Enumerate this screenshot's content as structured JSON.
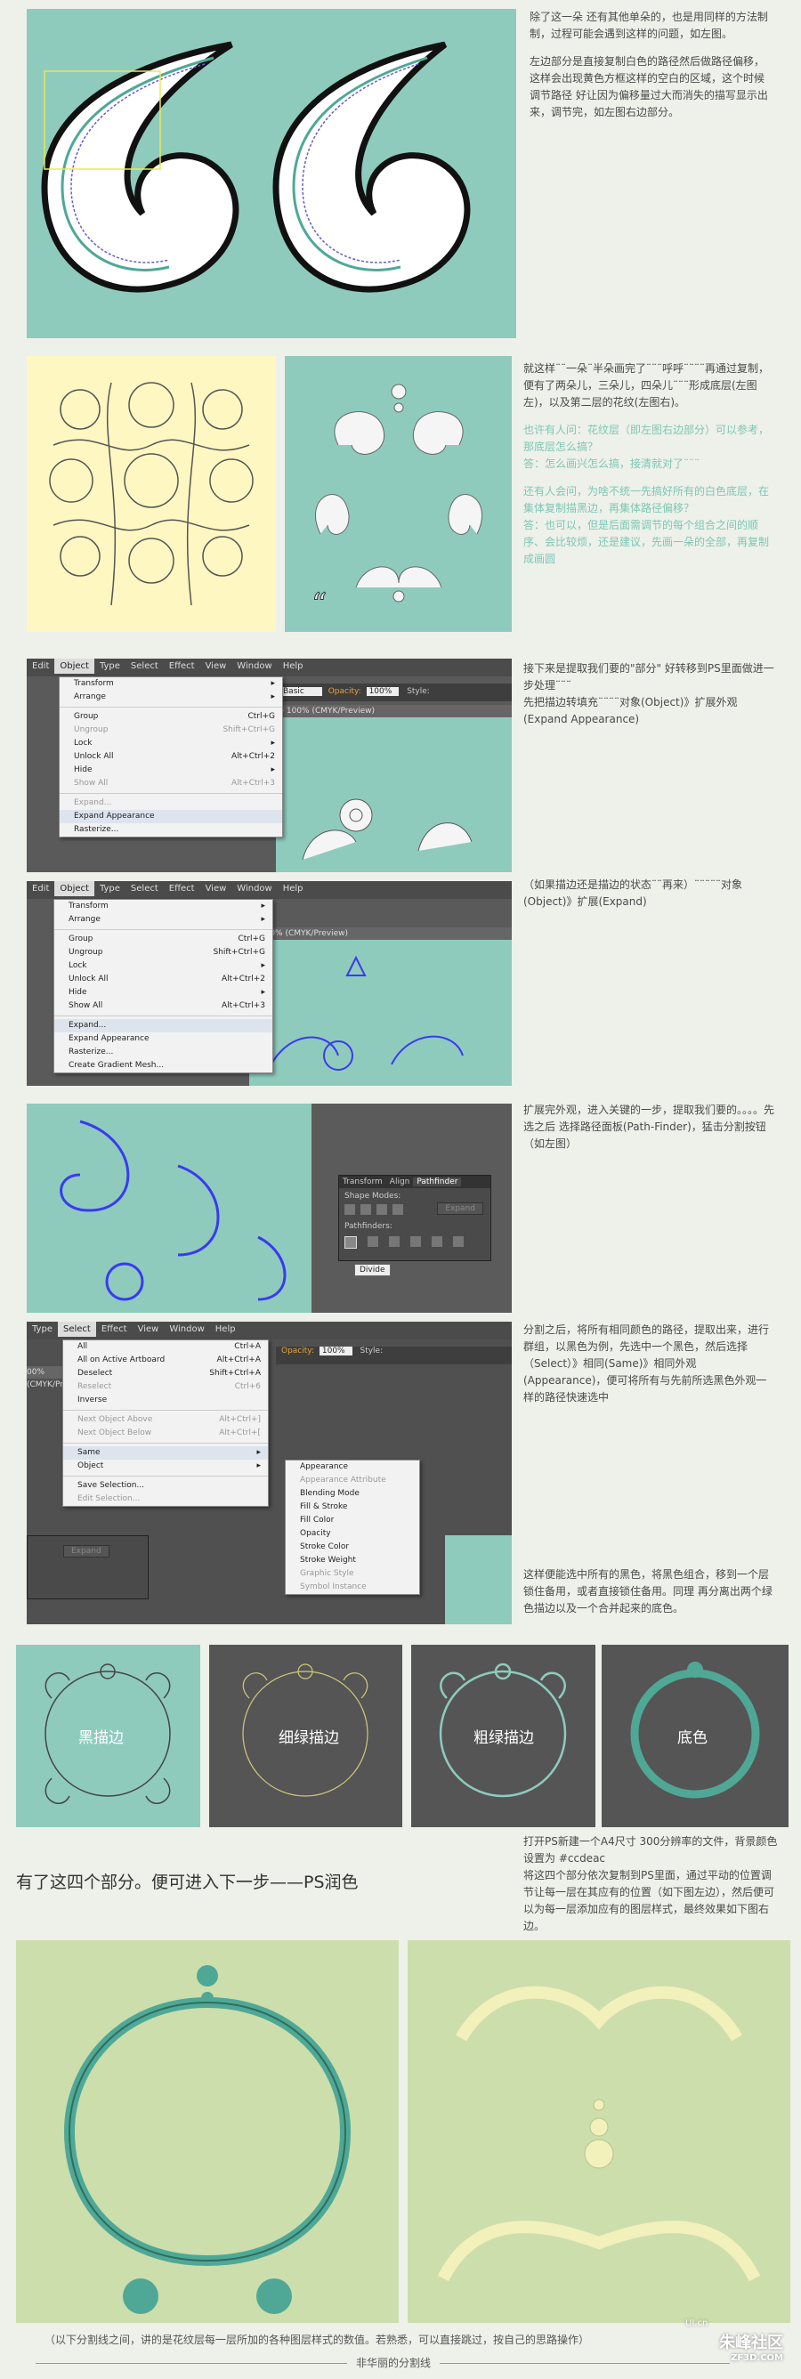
{
  "section1": {
    "text_black": "除了这一朵 还有其他单朵的，也是用同样的方法制制，过程可能会遇到这样的问题，如左图。",
    "text_black2": "左边部分是直接复制白色的路径然后做路径偏移，这样会出现黄色方框这样的空白的区域，这个时候调节路径 好让因为偏移量过大而消失的描写显示出来，调节完，如左图右边部分。"
  },
  "section2": {
    "text_black": "就这样¨¨一朵¨半朵画完了¨¨¨呼呼¨¨¨¨再通过复制，便有了两朵儿，三朵儿，四朵儿¨¨¨形成底层(左图左)，以及第二层的花纹(左图右)。",
    "teal_q1": "也许有人问：花纹层（即左图右边部分）可以参考，那底层怎么搞？",
    "teal_a1": "答：怎么画兴怎么搞，接清就对了¨¨¨",
    "teal_q2": "还有人会问，为啥不统一先搞好所有的白色底层，在集体复制描黑边，再集体路径偏移？",
    "teal_a2": "答：也可以，但是后面需调节的每个组合之间的顺序、会比较烦，还是建议，先画一朵的全部，再复制成画圆"
  },
  "section3": {
    "text": "接下来是提取我们要的\"部分\" 好转移到PS里面做进一步处理¨¨¨\n先把描边转填充¨¨¨¨对象(Object)》扩展外观(Expand Appearance)",
    "menubar": [
      "Edit",
      "Object",
      "Type",
      "Select",
      "Effect",
      "View",
      "Window",
      "Help"
    ],
    "menu_items": [
      {
        "label": "Transform",
        "shortcut": "▸"
      },
      {
        "label": "Arrange",
        "shortcut": "▸"
      },
      {
        "label": "Group",
        "shortcut": "Ctrl+G"
      },
      {
        "label": "Ungroup",
        "shortcut": "Shift+Ctrl+G"
      },
      {
        "label": "Lock",
        "shortcut": "▸"
      },
      {
        "label": "Unlock All",
        "shortcut": "Alt+Ctrl+2"
      },
      {
        "label": "Hide",
        "shortcut": "▸"
      },
      {
        "label": "Show All",
        "shortcut": "Alt+Ctrl+3"
      },
      {
        "label": "Expand...",
        "shortcut": ""
      },
      {
        "label": "Expand Appearance",
        "shortcut": ""
      },
      {
        "label": "Rasterize...",
        "shortcut": ""
      }
    ],
    "ctrl_basic": "Basic",
    "ctrl_opacity": "Opacity:",
    "ctrl_opacity_val": "100%",
    "ctrl_style": "Style:",
    "doc_tab": "@ 100% (CMYK/Preview)"
  },
  "section4": {
    "text": "（如果描边还是描边的状态¨¨再来）¨¨¨¨¨对象(Object)》扩展(Expand)",
    "menubar": [
      "Edit",
      "Object",
      "Type",
      "Select",
      "Effect",
      "View",
      "Window",
      "Help"
    ],
    "menu_items": [
      {
        "label": "Transform",
        "shortcut": "▸"
      },
      {
        "label": "Arrange",
        "shortcut": "▸"
      },
      {
        "label": "Group",
        "shortcut": "Ctrl+G"
      },
      {
        "label": "Ungroup",
        "shortcut": "Shift+Ctrl+G"
      },
      {
        "label": "Lock",
        "shortcut": "▸"
      },
      {
        "label": "Unlock All",
        "shortcut": "Alt+Ctrl+2"
      },
      {
        "label": "Hide",
        "shortcut": "▸"
      },
      {
        "label": "Show All",
        "shortcut": "Alt+Ctrl+3"
      },
      {
        "label": "Expand...",
        "shortcut": ""
      },
      {
        "label": "Expand Appearance",
        "shortcut": ""
      },
      {
        "label": "Rasterize...",
        "shortcut": ""
      },
      {
        "label": "Create Gradient Mesh...",
        "shortcut": ""
      }
    ],
    "doc_tab": "@ 100% (CMYK/Preview)"
  },
  "section5": {
    "text": "扩展完外观，进入关键的一步，提取我们要的。。。。先选之后 选择路径面板(Path-Finder)，猛击分割按钮（如左图）",
    "panel_tabs": [
      "Transform",
      "Align",
      "Pathfinder"
    ],
    "shape_modes": "Shape Modes:",
    "expand": "Expand",
    "pathfinders": "Pathfinders:",
    "tooltip": "Divide"
  },
  "section6": {
    "text1": "分割之后，将所有相同颜色的路径，提取出来，进行群组，以黑色为例，先选中一个黑色，然后选择（Select）》相同(Same)》相同外观(Appearance)，便可将所有与先前所选黑色外观一样的路径快速选中",
    "text2": "这样便能选中所有的黑色，将黑色组合，移到一个层锁住备用，或者直接锁住备用。同理 再分离出两个绿色描边以及一个合并起来的底色。",
    "menubar": [
      "Type",
      "Select",
      "Effect",
      "View",
      "Window",
      "Help"
    ],
    "select_items": [
      {
        "label": "All",
        "shortcut": "Ctrl+A"
      },
      {
        "label": "All on Active Artboard",
        "shortcut": "Alt+Ctrl+A"
      },
      {
        "label": "Deselect",
        "shortcut": "Shift+Ctrl+A"
      },
      {
        "label": "Reselect",
        "shortcut": "Ctrl+6"
      },
      {
        "label": "Inverse",
        "shortcut": ""
      },
      {
        "label": "Next Object Above",
        "shortcut": "Alt+Ctrl+]"
      },
      {
        "label": "Next Object Below",
        "shortcut": "Alt+Ctrl+["
      },
      {
        "label": "Same",
        "shortcut": "▸"
      },
      {
        "label": "Object",
        "shortcut": "▸"
      },
      {
        "label": "Save Selection...",
        "shortcut": ""
      },
      {
        "label": "Edit Selection...",
        "shortcut": ""
      }
    ],
    "same_items": [
      "Appearance",
      "Appearance Attribute",
      "Blending Mode",
      "Fill & Stroke",
      "Fill Color",
      "Opacity",
      "Stroke Color",
      "Stroke Weight",
      "Graphic Style",
      "Symbol Instance"
    ],
    "doc_tab": "00% (CMYK/Preview)",
    "opacity": "Opacity:",
    "opacity_val": "100%",
    "style": "Style:",
    "expand": "Expand"
  },
  "section7": {
    "labels": [
      "黑描边",
      "细绿描边",
      "粗绿描边",
      "底色"
    ]
  },
  "section8": {
    "heading": "有了这四个部分。便可进入下一步——PS润色",
    "text": "打开PS新建一个A4尺寸 300分辨率的文件，背景颜色设置为 #ccdeac\n将这四个部分依次复制到PS里面，通过平动的位置调节让每一层在其应有的位置（如下图左边），然后便可以为每一层添加应有的图层样式，最终效果如下图右边。"
  },
  "footer": {
    "note": "（以下分割线之间，讲的是花纹层每一层所加的各种图层样式的数值。若熟悉，可以直接跳过，按自己的思路操作）",
    "divider": "非华丽的分割线",
    "watermark": "UI.cn",
    "watermark2": "朱峰社区",
    "watermark3": "ZF3D.COM"
  },
  "colors": {
    "teal": "#8fcbbd",
    "dark_teal": "#4fa896",
    "cream": "#fff7c2",
    "bg_green": "#ccdeac",
    "gray_panel": "#555555"
  }
}
